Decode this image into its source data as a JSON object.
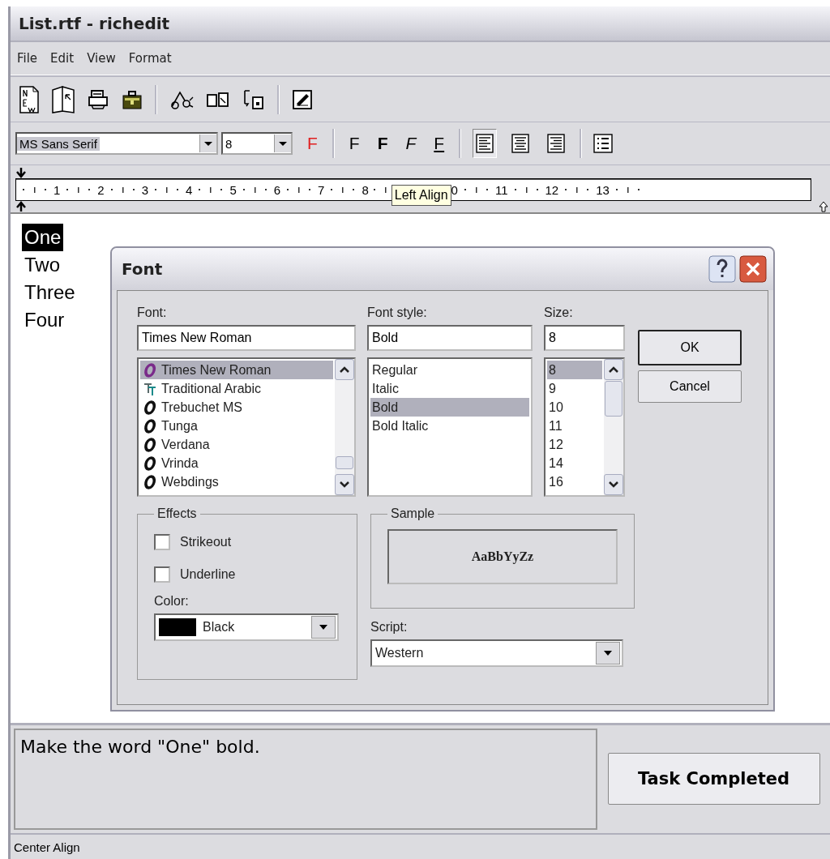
{
  "window": {
    "title": "List.rtf - richedit"
  },
  "menu": [
    "File",
    "Edit",
    "View",
    "Format"
  ],
  "format_bar": {
    "font": "MS Sans Serif",
    "size": "8",
    "style_buttons": [
      {
        "label": "F",
        "kind": "color"
      },
      {
        "label": "F",
        "kind": "regular"
      },
      {
        "label": "F",
        "kind": "bold"
      },
      {
        "label": "F",
        "kind": "italic"
      },
      {
        "label": "F",
        "kind": "underline"
      }
    ],
    "align_buttons": [
      {
        "kind": "left",
        "selected": true
      },
      {
        "kind": "center",
        "selected": false
      },
      {
        "kind": "right",
        "selected": false
      }
    ]
  },
  "ruler": {
    "left_numbers": [
      "1",
      "2",
      "3",
      "4",
      "5",
      "6",
      "7",
      "8"
    ],
    "tooltip": "Left Align",
    "right_numbers": [
      "0",
      "11",
      "12",
      "13"
    ]
  },
  "document": {
    "lines": [
      {
        "text": "One",
        "selected": true
      },
      {
        "text": "Two",
        "selected": false
      },
      {
        "text": "Three",
        "selected": false
      },
      {
        "text": "Four",
        "selected": false
      }
    ]
  },
  "font_dialog": {
    "title": "Font",
    "font": {
      "label": "Font:",
      "value": "Times New Roman",
      "items": [
        {
          "text": "Times New Roman",
          "kind": "opentype",
          "selected": true
        },
        {
          "text": "Traditional Arabic",
          "kind": "truetype",
          "selected": false
        },
        {
          "text": "Trebuchet MS",
          "kind": "opentype",
          "selected": false
        },
        {
          "text": "Tunga",
          "kind": "opentype",
          "selected": false
        },
        {
          "text": "Verdana",
          "kind": "opentype",
          "selected": false
        },
        {
          "text": "Vrinda",
          "kind": "opentype",
          "selected": false
        },
        {
          "text": "Webdings",
          "kind": "opentype",
          "selected": false
        }
      ]
    },
    "style": {
      "label": "Font style:",
      "value": "Bold",
      "items": [
        {
          "text": "Regular",
          "selected": false
        },
        {
          "text": "Italic",
          "selected": false
        },
        {
          "text": "Bold",
          "selected": true
        },
        {
          "text": "Bold Italic",
          "selected": false
        }
      ]
    },
    "size": {
      "label": "Size:",
      "value": "8",
      "items": [
        {
          "text": "8",
          "selected": true
        },
        {
          "text": "9",
          "selected": false
        },
        {
          "text": "10",
          "selected": false
        },
        {
          "text": "11",
          "selected": false
        },
        {
          "text": "12",
          "selected": false
        },
        {
          "text": "14",
          "selected": false
        },
        {
          "text": "16",
          "selected": false
        }
      ]
    },
    "buttons": [
      "OK",
      "Cancel"
    ],
    "effects": {
      "title": "Effects",
      "options": [
        {
          "label": "Strikeout",
          "checked": false
        },
        {
          "label": "Underline",
          "checked": false
        }
      ],
      "color_label": "Color:",
      "color": {
        "name": "Black",
        "color": "#000000"
      }
    },
    "sample": {
      "title": "Sample",
      "text": "AaBbYyZz"
    },
    "script": {
      "label": "Script:",
      "value": "Western"
    }
  },
  "task": {
    "instruction": "Make the word \"One\" bold.",
    "button": "Task Completed"
  },
  "status_bar": "Center Align"
}
